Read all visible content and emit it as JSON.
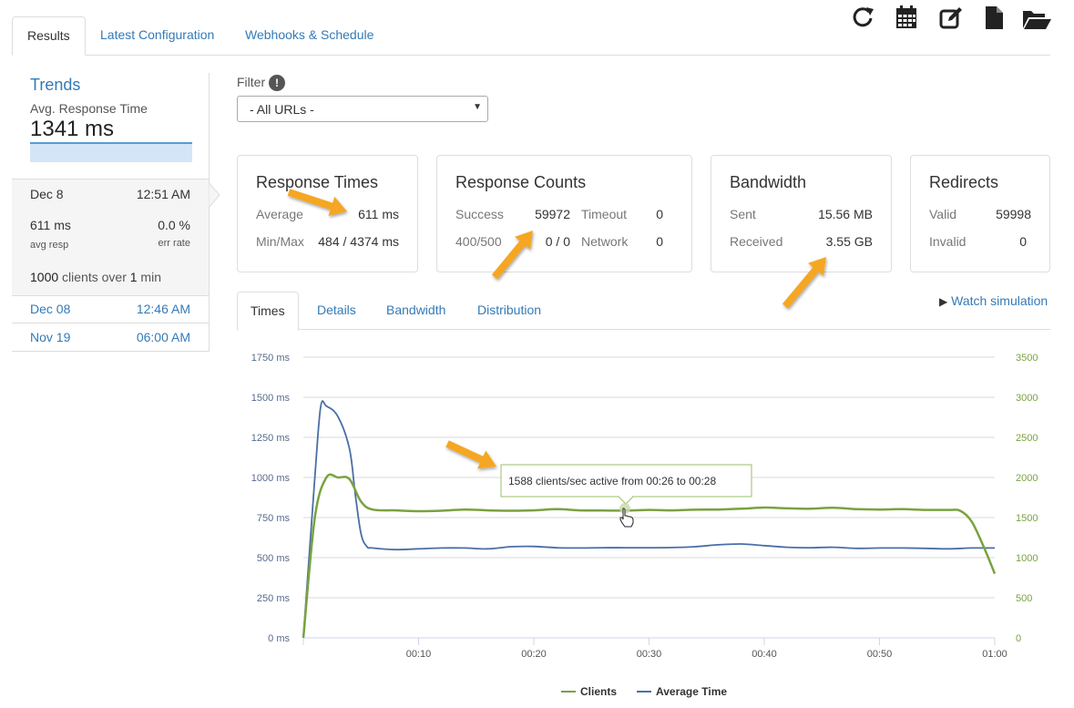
{
  "tabs": [
    "Results",
    "Latest Configuration",
    "Webhooks & Schedule"
  ],
  "toolbar": [
    "refresh-icon",
    "calendar-icon",
    "edit-icon",
    "file-icon",
    "folder-open-icon"
  ],
  "sidebar": {
    "title": "Trends",
    "subtitle": "Avg. Response Time",
    "value": "1341 ms",
    "current_run": {
      "date": "Dec 8",
      "time": "12:51 AM",
      "avg_resp": "611 ms",
      "avg_resp_label": "avg resp",
      "err_rate": "0.0 %",
      "err_rate_label": "err rate",
      "clients": "1000",
      "clients_over": " clients over ",
      "duration_num": "1",
      "duration_unit": " min"
    },
    "runs": [
      {
        "date": "Dec 08",
        "time": "12:46 AM"
      },
      {
        "date": "Nov 19",
        "time": "06:00 AM"
      }
    ]
  },
  "filter": {
    "label": "Filter",
    "info": "!",
    "selected": "- All URLs -"
  },
  "cards": {
    "response_times": {
      "title": "Response Times",
      "avg_label": "Average",
      "avg": "611 ms",
      "minmax_label": "Min/Max",
      "minmax": "484 / 4374 ms"
    },
    "response_counts": {
      "title": "Response Counts",
      "success_label": "Success",
      "success": "59972",
      "timeout_label": "Timeout",
      "timeout": "0",
      "err_label": "400/500",
      "err": "0 / 0",
      "network_label": "Network",
      "network": "0"
    },
    "bandwidth": {
      "title": "Bandwidth",
      "sent_label": "Sent",
      "sent": "15.56 MB",
      "received_label": "Received",
      "received": "3.55 GB"
    },
    "redirects": {
      "title": "Redirects",
      "valid_label": "Valid",
      "valid": "59998",
      "invalid_label": "Invalid",
      "invalid": "0"
    }
  },
  "chart_tabs": [
    "Times",
    "Details",
    "Bandwidth",
    "Distribution"
  ],
  "watch_simulation": "Watch simulation",
  "colors": {
    "clients": "#7aa23f",
    "average_time": "#4a6fa5",
    "link": "#337ab7",
    "arrow": "#f5a623"
  },
  "chart_data": {
    "type": "line",
    "x_ticks": [
      "00:10",
      "00:20",
      "00:30",
      "00:40",
      "00:50",
      "01:00"
    ],
    "y_left_ticks": [
      "0 ms",
      "250 ms",
      "500 ms",
      "750 ms",
      "1000 ms",
      "1250 ms",
      "1500 ms",
      "1750 ms"
    ],
    "y_right_ticks": [
      "0",
      "500",
      "1000",
      "1500",
      "2000",
      "2500",
      "3000",
      "3500"
    ],
    "ylim_left": [
      0,
      1750
    ],
    "ylim_right": [
      0,
      3500
    ],
    "xlim_seconds": [
      0,
      60
    ],
    "tooltip": "1588 clients/sec active from 00:26 to 00:28",
    "series": [
      {
        "name": "Clients",
        "axis": "right",
        "x": [
          0,
          1,
          2,
          3,
          4,
          5,
          6,
          8,
          10,
          12,
          14,
          16,
          18,
          20,
          22,
          24,
          26,
          28,
          30,
          32,
          34,
          36,
          38,
          40,
          42,
          44,
          46,
          48,
          50,
          52,
          54,
          56,
          57,
          58,
          59,
          60
        ],
        "values": [
          0,
          1500,
          2000,
          2000,
          1980,
          1700,
          1600,
          1590,
          1580,
          1585,
          1600,
          1590,
          1585,
          1590,
          1605,
          1590,
          1588,
          1588,
          1595,
          1590,
          1598,
          1600,
          1610,
          1625,
          1615,
          1610,
          1622,
          1605,
          1600,
          1605,
          1595,
          1595,
          1585,
          1450,
          1150,
          800
        ]
      },
      {
        "name": "Average Time",
        "axis": "left",
        "x": [
          0,
          1,
          1.5,
          2,
          3,
          4,
          4.5,
          5,
          5.5,
          6,
          8,
          10,
          12,
          14,
          16,
          18,
          20,
          22,
          24,
          26,
          28,
          30,
          32,
          34,
          36,
          38,
          40,
          42,
          44,
          46,
          48,
          50,
          52,
          54,
          56,
          58,
          60
        ],
        "values": [
          0,
          1000,
          1440,
          1445,
          1380,
          1180,
          900,
          650,
          570,
          560,
          550,
          555,
          560,
          560,
          555,
          568,
          570,
          562,
          560,
          562,
          562,
          562,
          563,
          568,
          580,
          585,
          575,
          565,
          562,
          565,
          558,
          560,
          560,
          558,
          555,
          560,
          560
        ]
      }
    ]
  }
}
